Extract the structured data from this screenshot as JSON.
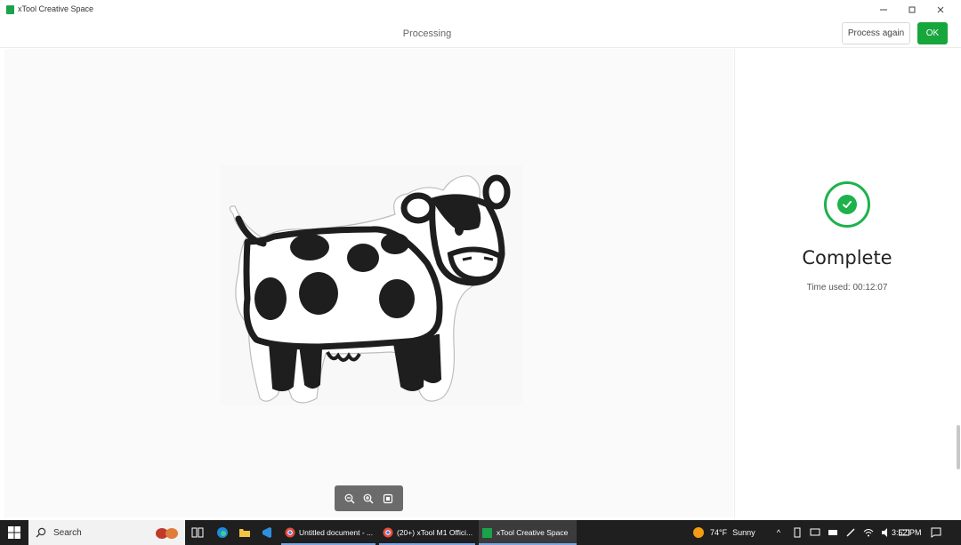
{
  "window": {
    "title": "xTool Creative Space",
    "controls": {
      "minimize": "—",
      "maximize": "☐",
      "close": "✕"
    }
  },
  "toolbar": {
    "status": "Processing",
    "process_again_label": "Process again",
    "ok_label": "OK"
  },
  "result": {
    "title": "Complete",
    "time_used": "Time used: 00:12:07"
  },
  "zoom": {
    "icons": [
      "zoom-out-icon",
      "zoom-in-icon",
      "fit-screen-icon"
    ]
  },
  "taskbar": {
    "search_label": "Search",
    "apps": [
      {
        "label": "Untitled document - ...",
        "icon": "chrome-icon"
      },
      {
        "label": "(20+) xTool M1 Offici...",
        "icon": "chrome-icon"
      },
      {
        "label": "xTool Creative Space",
        "icon": "xtool-icon"
      }
    ],
    "weather": {
      "temp": "74°F",
      "condition": "Sunny"
    },
    "clock": "3:52 PM"
  },
  "colors": {
    "accent": "#16a63b",
    "success": "#1db24b",
    "taskbar": "#1f1f1f"
  }
}
